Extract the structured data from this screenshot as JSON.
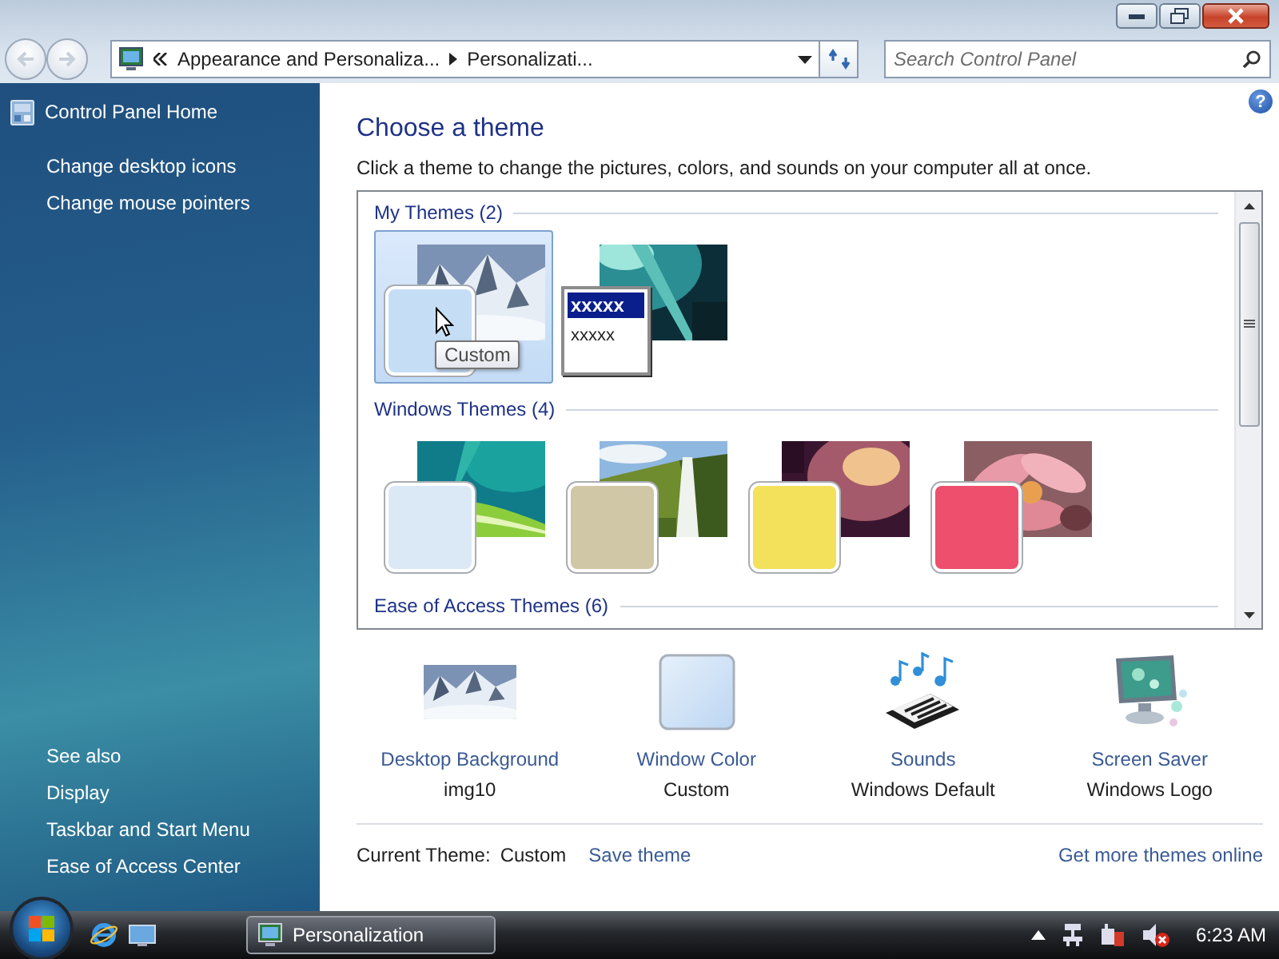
{
  "address_bar": {
    "crumbs": [
      "Appearance and Personaliza...",
      "Personalizati..."
    ]
  },
  "search": {
    "placeholder": "Search Control Panel"
  },
  "help": "?",
  "sidebar": {
    "items": [
      {
        "label": "Control Panel Home",
        "kind": "home"
      },
      {
        "label": "Change desktop icons",
        "kind": "link"
      },
      {
        "label": "Change mouse pointers",
        "kind": "link"
      }
    ],
    "see_also": {
      "title": "See also",
      "items": [
        "Display",
        "Taskbar and Start Menu",
        "Ease of Access Center"
      ]
    }
  },
  "content": {
    "title": "Choose a theme",
    "description": "Click a theme to change the pictures, colors, and sounds on your computer all at once.",
    "theme_groups": [
      {
        "label": "My Themes (2)",
        "themes": [
          {
            "kind": "swatch",
            "color": "#c6ddf6",
            "selected": true,
            "tooltip": "Custom"
          },
          {
            "kind": "window-sample",
            "selected": false,
            "sample_lines": [
              "xxxxx",
              "xxxxx"
            ]
          }
        ]
      },
      {
        "label": "Windows Themes (4)",
        "themes": [
          {
            "kind": "swatch",
            "color": "#dbe9f7",
            "selected": false
          },
          {
            "kind": "swatch",
            "color": "#cfc7a6",
            "selected": false
          },
          {
            "kind": "swatch",
            "color": "#f3e15c",
            "selected": false
          },
          {
            "kind": "swatch",
            "color": "#ee4f6c",
            "selected": false
          }
        ]
      },
      {
        "label": "Ease of Access Themes (6)"
      }
    ],
    "settings": [
      {
        "kind": "background",
        "title": "Desktop Background",
        "value": "img10"
      },
      {
        "kind": "color",
        "title": "Window Color",
        "value": "Custom"
      },
      {
        "kind": "sounds",
        "title": "Sounds",
        "value": "Windows Default"
      },
      {
        "kind": "screensaver",
        "title": "Screen Saver",
        "value": "Windows Logo"
      }
    ],
    "footer": {
      "label": "Current Theme:",
      "value": "Custom",
      "save_link": "Save theme",
      "more_link": "Get more themes online"
    }
  },
  "taskbar": {
    "tasks": [
      {
        "label": "Personalization",
        "selected": true
      }
    ],
    "clock": "6:23 AM"
  }
}
